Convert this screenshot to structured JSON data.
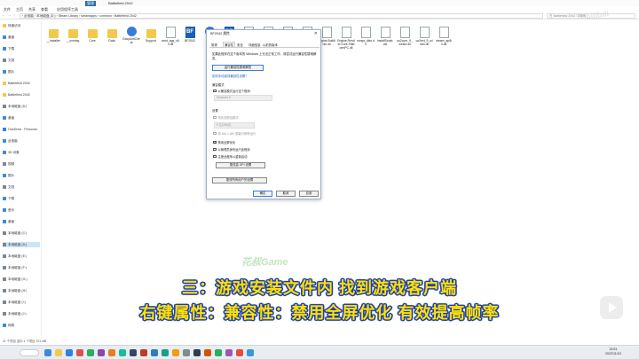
{
  "window": {
    "tab_label": "管理",
    "app_title": "Battlefield 2042",
    "menu": [
      "文件",
      "主页",
      "共享",
      "查看",
      "应用程序工具"
    ]
  },
  "address": {
    "nav": "← → ↑",
    "path": "› 此电脑 › 本地磁盘 (D:) › Steam Library › steamapps › common › Battlefield 2042",
    "search": "在 Battlefield 2042 中搜索"
  },
  "sidebar": {
    "items": [
      {
        "label": "快速访问",
        "icon": "star-icon",
        "color": "#f2c94c"
      },
      {
        "label": "桌面",
        "icon": "desktop-icon",
        "color": "#3c8bd9"
      },
      {
        "label": "下载",
        "icon": "download-icon",
        "color": "#3c8bd9"
      },
      {
        "label": "文档",
        "icon": "document-icon",
        "color": "#7a8793"
      },
      {
        "label": "图片",
        "icon": "picture-icon",
        "color": "#3c8bd9"
      },
      {
        "label": "Battlefield 2042",
        "icon": "folder-icon",
        "color": "#f2c94c"
      },
      {
        "label": "Battlefield 2042",
        "icon": "folder-icon",
        "color": "#f2c94c"
      },
      {
        "label": "本地磁盘 (D:)",
        "icon": "drive-icon",
        "color": "#7a8793"
      },
      {
        "label": "桌面",
        "icon": "desktop-icon",
        "color": "#3c8bd9"
      },
      {
        "label": "OneDrive - Personal",
        "icon": "cloud-icon",
        "color": "#2f80ed"
      },
      {
        "label": "此电脑",
        "icon": "pc-icon",
        "color": "#3c8bd9"
      },
      {
        "label": "3D 对象",
        "icon": "cube-icon",
        "color": "#3c8bd9"
      },
      {
        "label": "视频",
        "icon": "video-icon",
        "color": "#7a8793"
      },
      {
        "label": "图片",
        "icon": "picture-icon",
        "color": "#3c8bd9"
      },
      {
        "label": "文档",
        "icon": "document-icon",
        "color": "#7a8793"
      },
      {
        "label": "下载",
        "icon": "download-icon",
        "color": "#3c8bd9"
      },
      {
        "label": "音乐",
        "icon": "music-icon",
        "color": "#3c8bd9"
      },
      {
        "label": "桌面",
        "icon": "desktop-icon",
        "color": "#3c8bd9"
      },
      {
        "label": "本地磁盘 (C:)",
        "icon": "drive-icon",
        "color": "#7a8793"
      },
      {
        "label": "本地磁盘 (D:)",
        "icon": "drive-icon",
        "color": "#7a8793"
      },
      {
        "label": "本地磁盘 (E:)",
        "icon": "drive-icon",
        "color": "#7a8793"
      },
      {
        "label": "本地磁盘 (F:)",
        "icon": "drive-icon",
        "color": "#7a8793"
      },
      {
        "label": "本地磁盘 (G:)",
        "icon": "drive-icon",
        "color": "#7a8793"
      },
      {
        "label": "本地磁盘 (H:)",
        "icon": "drive-icon",
        "color": "#7a8793"
      },
      {
        "label": "本地磁盘 (I:)",
        "icon": "drive-icon",
        "color": "#7a8793"
      },
      {
        "label": "本地磁盘 (J:)",
        "icon": "drive-icon",
        "color": "#7a8793"
      },
      {
        "label": "网络",
        "icon": "network-icon",
        "color": "#3c8bd9"
      }
    ],
    "selected_index": 19
  },
  "files": [
    {
      "name": "__Installer",
      "kind": "folder"
    },
    {
      "name": "__overlay",
      "kind": "folder"
    },
    {
      "name": "Core",
      "kind": "folder"
    },
    {
      "name": "Data",
      "kind": "folder"
    },
    {
      "name": "EasyAntiCheat",
      "kind": "disc"
    },
    {
      "name": "Support",
      "kind": "folder"
    },
    {
      "name": "amd_ags_x64.dll",
      "kind": "doc"
    },
    {
      "name": "BF2042",
      "kind": "bf"
    },
    {
      "name": "",
      "kind": "disc"
    },
    {
      "name": "",
      "kind": "bf"
    },
    {
      "name": "",
      "kind": "doc"
    },
    {
      "name": "",
      "kind": "doc"
    },
    {
      "name": "dxil.dll",
      "kind": "doc"
    },
    {
      "name": "Datalink",
      "kind": "doc"
    },
    {
      "name": "Engine.BuildInfo.dll",
      "kind": "doc"
    },
    {
      "name": "Engine.Render.Core.PlatformPC.dll",
      "kind": "doc"
    },
    {
      "name": "nvngx_dlss.dll",
      "kind": "doc"
    },
    {
      "name": "InstallScript.vdf",
      "kind": "doc"
    },
    {
      "name": "oo2core_9_win64.dll",
      "kind": "doc"
    },
    {
      "name": "oo2ext_9_win64.dll",
      "kind": "doc"
    },
    {
      "name": "steam_api64.dll",
      "kind": "doc"
    }
  ],
  "status": "21 个项目   选中 1 个项目  321 MB",
  "dialog": {
    "title": "BF2042 属性",
    "close": "✕",
    "tabs": [
      "常规",
      "兼容性",
      "安全",
      "详细信息",
      "以前的版本"
    ],
    "active_tab": 1,
    "intro": "如果此程序在这个版本的 Windows 上无法正常工作，请尝试运行兼容性疑难解答。",
    "troubleshoot_button": "运行兼容性疑难解答",
    "manual_link": "如何手动选择兼容性设置？",
    "compat_mode_header": "兼容模式",
    "compat_mode_checkbox": "以兼容模式运行这个程序：",
    "compat_mode_select": "Windows 8",
    "settings_header": "设置",
    "reduced_color": "简化的颜色模式",
    "color_select": "8 位(256)色",
    "resolution_640": "用 640 x 480 屏幕分辨率运行",
    "disable_fullscreen": "禁用全屏优化",
    "run_as_admin": "以管理员身份运行此程序",
    "register_restart": "注册此程序以重新启动",
    "dpi_button": "更改高 DPI 设置",
    "all_users_button": "更改所有用户的设置",
    "ok": "确定",
    "cancel": "取消",
    "apply": "应用"
  },
  "taskbar": {
    "clock_time": "14:51",
    "clock_date": "2022/11/10",
    "app_colors": [
      "#3c8bd9",
      "#f2c94c",
      "#2f80ed",
      "#d9534f",
      "#27ae60",
      "#8e44ad",
      "#e67e22",
      "#1abc9c",
      "#34495e",
      "#c0392b",
      "#2980b9",
      "#16a085",
      "#f39c12",
      "#7f8c8d",
      "#2c3e50",
      "#d35400",
      "#27ae60",
      "#9b59b6",
      "#e74c3c",
      "#3498db"
    ]
  },
  "overlay": {
    "watermark_top": "bilibili",
    "brand": "花叔Game",
    "subtitle_line1": "三：游戏安装文件内 找到游戏客户端",
    "subtitle_line2": "右键属性：兼容性：禁用全屏优化 有效提高帧率"
  }
}
